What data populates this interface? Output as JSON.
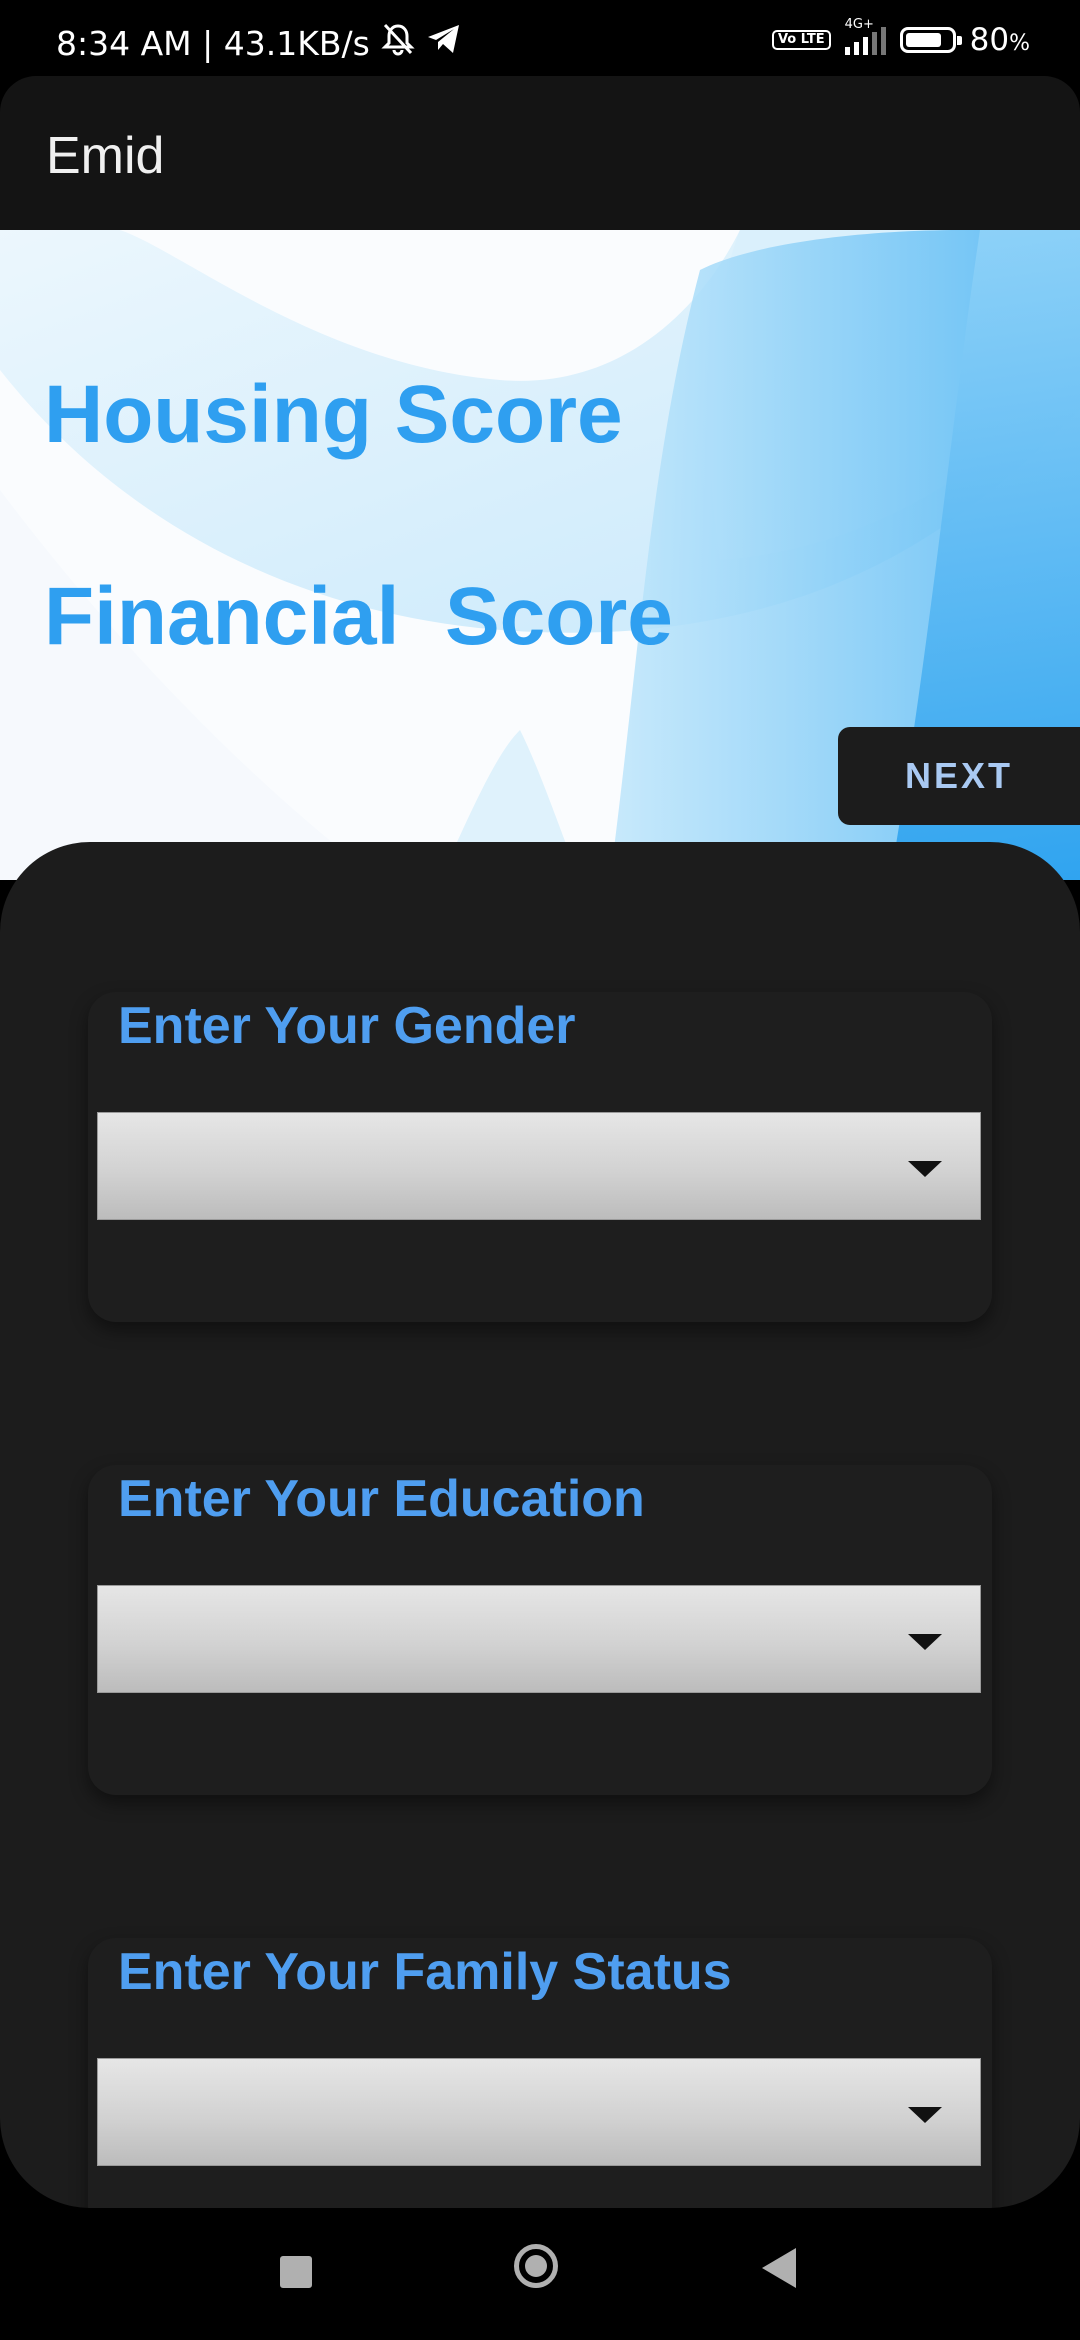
{
  "status_bar": {
    "time_speed": "8:34 AM | 43.1KB/s",
    "volte": "Vo LTE",
    "network": "4G+",
    "battery_percent": "80",
    "battery_unit": "%",
    "battery_level": 0.8
  },
  "app_bar": {
    "title": "Emid"
  },
  "hero": {
    "line1": "Housing Score",
    "line2": "Financial  Score",
    "next_label": "NEXT"
  },
  "form": {
    "fields": [
      {
        "label": "Enter Your Gender",
        "value": ""
      },
      {
        "label": "Enter Your Education",
        "value": ""
      },
      {
        "label": "Enter Your Family Status",
        "value": ""
      }
    ]
  },
  "colors": {
    "accent_text": "#2f9ff0",
    "label_text": "#4f9ef0",
    "panel": "#1c1c1c"
  }
}
